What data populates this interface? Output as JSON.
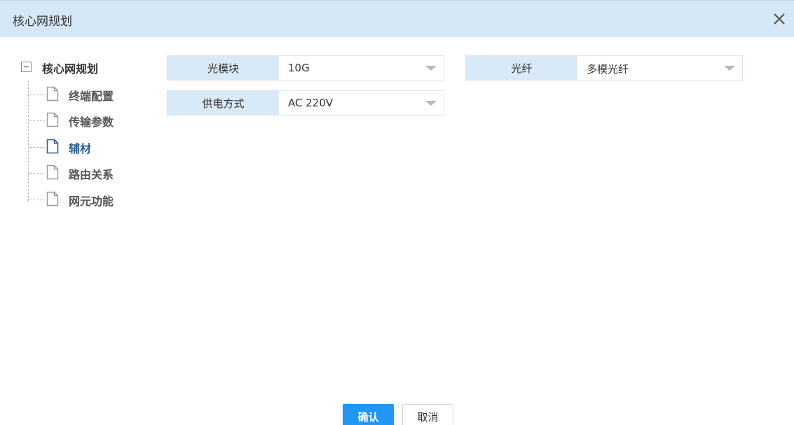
{
  "dialog": {
    "title": "核心网规划"
  },
  "tree": {
    "root_label": "核心网规划",
    "items": [
      {
        "label": "终端配置",
        "selected": false
      },
      {
        "label": "传输参数",
        "selected": false
      },
      {
        "label": "辅材",
        "selected": true
      },
      {
        "label": "路由关系",
        "selected": false
      },
      {
        "label": "网元功能",
        "selected": false
      }
    ]
  },
  "form": {
    "optical_module": {
      "label": "光模块",
      "value": "10G"
    },
    "fiber": {
      "label": "光纤",
      "value": "多模光纤"
    },
    "power_supply": {
      "label": "供电方式",
      "value": "AC 220V"
    }
  },
  "buttons": {
    "confirm": "确认",
    "cancel": "取消"
  },
  "colors": {
    "titlebar_bg": "#d6e8f7",
    "label_bg": "#d8e9f8",
    "primary": "#2196f3",
    "selected_text": "#2d5a96"
  },
  "icons": {
    "close": "close-icon",
    "collapse": "minus-toggle-icon",
    "doc": "document-icon"
  }
}
